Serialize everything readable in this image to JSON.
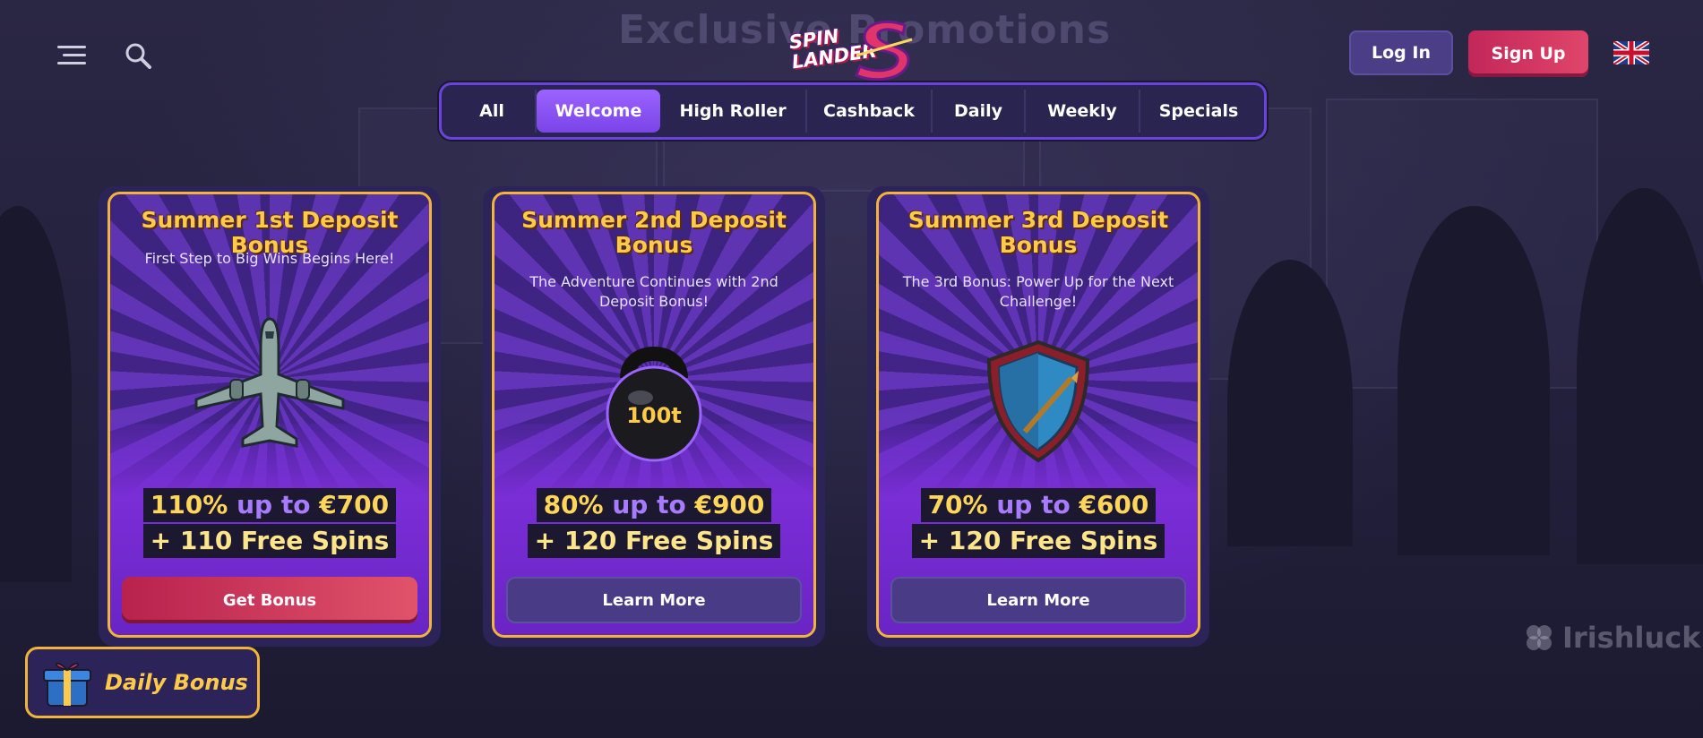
{
  "background": {
    "title": "Exclusive Promotions"
  },
  "header": {
    "menu_icon": "hamburger-icon",
    "search_icon": "search-icon",
    "logo_text_line1": "SPIN",
    "logo_text_line2": "LANDER",
    "login_label": "Log In",
    "signup_label": "Sign Up",
    "language_flag": "uk-flag-icon"
  },
  "tabs": [
    {
      "label": "All",
      "active": false
    },
    {
      "label": "Welcome",
      "active": true
    },
    {
      "label": "High Roller",
      "active": false
    },
    {
      "label": "Cashback",
      "active": false
    },
    {
      "label": "Daily",
      "active": false
    },
    {
      "label": "Weekly",
      "active": false
    },
    {
      "label": "Specials",
      "active": false
    }
  ],
  "cards": [
    {
      "title": "Summer 1st Deposit Bonus",
      "subtitle": "First Step to Big Wins Begins Here!",
      "icon": "airplane-icon",
      "offer_pct": "110%",
      "offer_up_to": "up to",
      "offer_amount": "€700",
      "offer_spins": "+ 110 Free Spins",
      "button": "Get Bonus"
    },
    {
      "title": "Summer 2nd Deposit Bonus",
      "subtitle": "The Adventure Continues with 2nd Deposit Bonus!",
      "icon": "kettlebell-icon",
      "icon_text": "100t",
      "offer_pct": "80%",
      "offer_up_to": "up to",
      "offer_amount": "€900",
      "offer_spins": "+ 120 Free Spins",
      "button": "Learn More"
    },
    {
      "title": "Summer 3rd Deposit Bonus",
      "subtitle": "The 3rd Bonus: Power Up for the Next Challenge!",
      "icon": "shield-icon",
      "offer_pct": "70%",
      "offer_up_to": "up to",
      "offer_amount": "€600",
      "offer_spins": "+ 120 Free Spins",
      "button": "Learn More"
    }
  ],
  "daily_bonus": {
    "label": "Daily Bonus",
    "icon": "gift-box-icon"
  },
  "watermark": {
    "text": "Irishluck",
    "icon": "clover-icon"
  }
}
